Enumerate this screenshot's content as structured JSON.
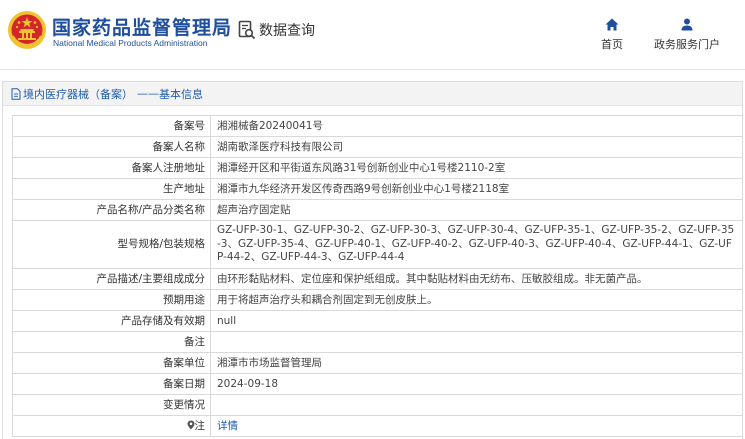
{
  "header": {
    "site_title": "国家药品监督管理局",
    "site_title_en": "National Medical Products Administration",
    "query_label": "数据查询",
    "nav": [
      {
        "label": "首页",
        "icon": "home-icon"
      },
      {
        "label": "政务服务门户",
        "icon": "user-icon"
      }
    ]
  },
  "breadcrumb": {
    "section": "境内医疗器械（备案）",
    "separator": "——",
    "current": "基本信息"
  },
  "record": [
    {
      "label": "备案号",
      "value": "湘湘械备20240041号"
    },
    {
      "label": "备案人名称",
      "value": "湖南歌泽医疗科技有限公司"
    },
    {
      "label": "备案人注册地址",
      "value": "湘潭经开区和平街道东风路31号创新创业中心1号楼2110-2室"
    },
    {
      "label": "生产地址",
      "value": "湘潭市九华经济开发区传奇西路9号创新创业中心1号楼2118室"
    },
    {
      "label": "产品名称/产品分类名称",
      "value": "超声治疗固定贴"
    },
    {
      "label": "型号规格/包装规格",
      "value": "GZ-UFP-30-1、GZ-UFP-30-2、GZ-UFP-30-3、GZ-UFP-30-4、GZ-UFP-35-1、GZ-UFP-35-2、GZ-UFP-35-3、GZ-UFP-35-4、GZ-UFP-40-1、GZ-UFP-40-2、GZ-UFP-40-3、GZ-UFP-40-4、GZ-UFP-44-1、GZ-UFP-44-2、GZ-UFP-44-3、GZ-UFP-44-4"
    },
    {
      "label": "产品描述/主要组成成分",
      "value": "由环形黏贴材料、定位座和保护纸组成。其中黏贴材料由无纺布、压敏胶组成。非无菌产品。"
    },
    {
      "label": "预期用途",
      "value": "用于将超声治疗头和耦合剂固定到无创皮肤上。"
    },
    {
      "label": "产品存储及有效期",
      "value": "null"
    },
    {
      "label": "备注",
      "value": ""
    },
    {
      "label": "备案单位",
      "value": "湘潭市市场监督管理局"
    },
    {
      "label": "备案日期",
      "value": "2024-09-18"
    },
    {
      "label": "变更情况",
      "value": ""
    },
    {
      "label": "注",
      "value": "详情"
    }
  ],
  "colors": {
    "brand_blue": "#1f4f9c",
    "link_blue": "#1f5cab",
    "emblem_red": "#d3262b",
    "emblem_gold": "#f2c230"
  }
}
